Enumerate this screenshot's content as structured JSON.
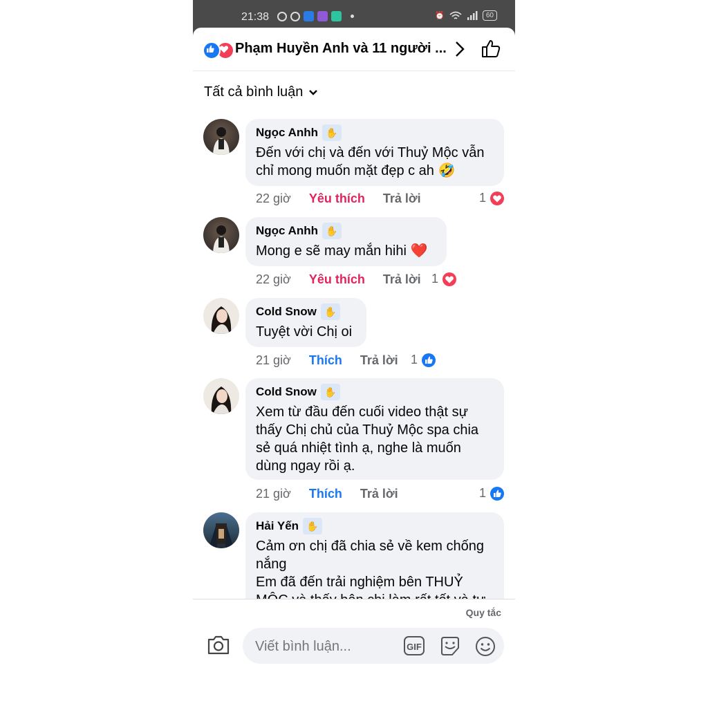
{
  "status_bar": {
    "time": "21:38",
    "battery": "60"
  },
  "header": {
    "title": "Phạm Huyền Anh và 11 người ..."
  },
  "filter": {
    "label": "Tất cả bình luận"
  },
  "comments": [
    {
      "author": "Ngọc Anhh",
      "text": "Đến với chị và đến với Thuỷ Mộc vẫn\nchỉ mong muốn mặt đẹp c ah 🤣",
      "time": "22 giờ",
      "action_like": "Yêu thích",
      "action_reply": "Trả lời",
      "reaction_count": "1",
      "reaction": "love"
    },
    {
      "author": "Ngọc Anhh",
      "text": "Mong e sẽ may mắn hihi ❤️",
      "time": "22 giờ",
      "action_like": "Yêu thích",
      "action_reply": "Trả lời",
      "reaction_count": "1",
      "reaction": "love"
    },
    {
      "author": "Cold Snow",
      "text": "Tuyệt vời Chị oi",
      "time": "21 giờ",
      "action_like": "Thích",
      "action_reply": "Trả lời",
      "reaction_count": "1",
      "reaction": "like"
    },
    {
      "author": "Cold Snow",
      "text": "Xem từ đầu đến cuối video thật sự\nthấy Chị chủ của Thuỷ Mộc spa chia\nsẻ quá nhiệt tình ạ, nghe là muốn\ndùng ngay rồi ạ.",
      "time": "21 giờ",
      "action_like": "Thích",
      "action_reply": "Trả lời",
      "reaction_count": "1",
      "reaction": "like"
    },
    {
      "author": "Hải Yến",
      "text": "Cảm ơn chị đã chia sẻ về kem chống\nnắng\nEm đã đến trải nghiệm bên THUỶ\nMỘC và thấy bên chị làm rất tốt và tư"
    }
  ],
  "footer": {
    "rules_label": "Quy tắc",
    "composer_placeholder": "Viết bình luận..."
  },
  "colors": {
    "accent": "#1877f2",
    "love": "#f33e58",
    "bubble": "#f0f2f5"
  }
}
